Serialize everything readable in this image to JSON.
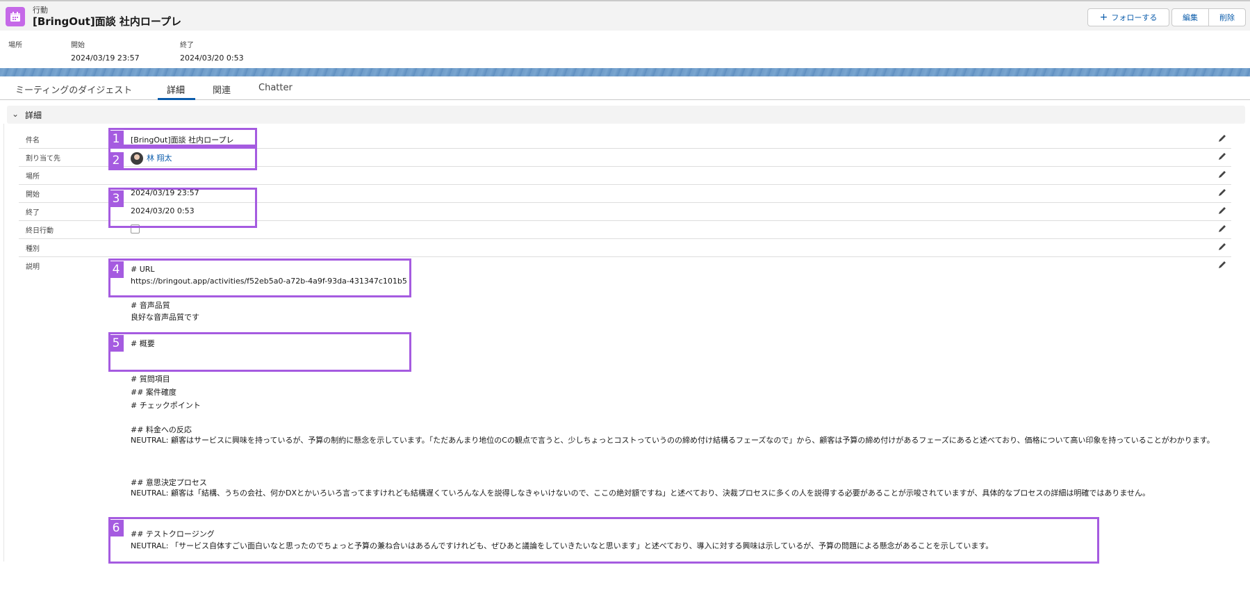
{
  "header": {
    "object_type": "行動",
    "title": "[BringOut]面談 社内ロープレ",
    "follow_label": "フォローする",
    "edit_label": "編集",
    "delete_label": "削除",
    "icon": "calendar-icon",
    "accent_color": "#c569e8"
  },
  "highlights": {
    "location_label": "場所",
    "start_label": "開始",
    "start_value": "2024/03/19 23:57",
    "end_label": "終了",
    "end_value": "2024/03/20 0:53"
  },
  "tabs": [
    {
      "label": "ミーティングのダイジェスト"
    },
    {
      "label": "詳細"
    },
    {
      "label": "関連"
    },
    {
      "label": "Chatter"
    }
  ],
  "section": {
    "title": "詳細"
  },
  "fields": {
    "subject": {
      "label": "件名",
      "value": "[BringOut]面談 社内ロープレ"
    },
    "assignee": {
      "label": "割り当て先",
      "value": "林 翔太"
    },
    "location": {
      "label": "場所",
      "value": ""
    },
    "start": {
      "label": "開始",
      "value": "2024/03/19 23:57"
    },
    "end": {
      "label": "終了",
      "value": "2024/03/20 0:53"
    },
    "all_day": {
      "label": "終日行動",
      "checked": false
    },
    "type": {
      "label": "種別",
      "value": ""
    },
    "description": {
      "label": "説明"
    }
  },
  "description": {
    "url_heading": "# URL",
    "url": "https://bringout.app/activities/f52eb5a0-a72b-4a9f-93da-431347c101b5",
    "audio_heading": "# 音声品質",
    "audio_text": "良好な音声品質です",
    "summary_heading": "# 概要",
    "questions_heading": "# 質問項目",
    "deal_heading": "## 案件確度",
    "checkpoint_heading": "# チェックポイント",
    "pricing_heading": "## 料金への反応",
    "pricing_text": "NEUTRAL: 顧客はサービスに興味を持っているが、予算の制約に懸念を示しています。「ただあんまり地位のCの観点で言うと、少しちょっとコストっていうのの締め付け結構るフェーズなので」から、顧客は予算の締め付けがあるフェーズにあると述べており、価格について高い印象を持っていることがわかります。",
    "decision_heading": "## 意思決定プロセス",
    "decision_text": "NEUTRAL: 顧客は「結構、うちの会社、何かDXとかいろいろ言ってますけれども結構遅くていろんな人を説得しなきゃいけないので、ここの絶対額ですね」と述べており、決裁プロセスに多くの人を説得する必要があることが示唆されていますが、具体的なプロセスの詳細は明確ではありません。",
    "closing_heading": "## テストクロージング",
    "closing_text": "NEUTRAL: 「サービス自体すごい面白いなと思ったのでちょっと予算の兼ね合いはあるんですけれども、ぜひあと議論をしていきたいなと思います」と述べており、導入に対する興味は示しているが、予算の問題による懸念があることを示しています。"
  },
  "callouts": [
    "1",
    "2",
    "3",
    "4",
    "5",
    "6"
  ],
  "colors": {
    "callout": "#a55be0",
    "link": "#0b5cab"
  }
}
